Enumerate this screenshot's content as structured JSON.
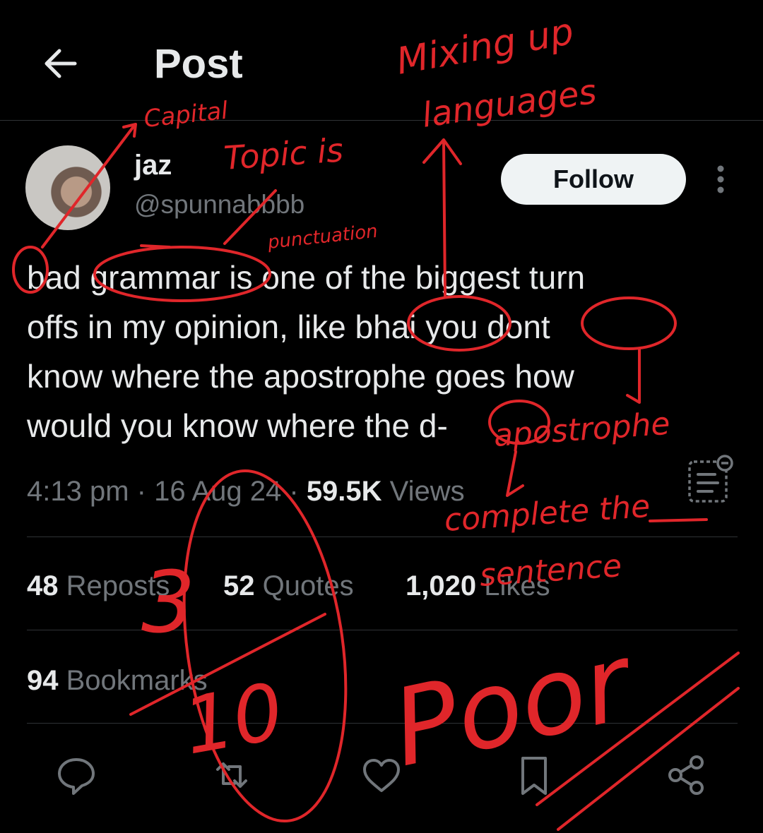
{
  "header": {
    "title": "Post"
  },
  "author": {
    "display_name": "jaz",
    "handle": "@spunnabbbb",
    "follow_label": "Follow"
  },
  "tweet": {
    "lines": [
      "bad grammar is one of the biggest turn",
      "offs in my opinion, like bhai you dont",
      "know where the apostrophe goes how",
      "would you know where the d-"
    ]
  },
  "meta": {
    "time": "4:13 pm",
    "sep1": " · ",
    "date": "16 Aug 24",
    "sep2": " · ",
    "views_count": "59.5K",
    "views_label": " Views"
  },
  "stats": {
    "reposts_count": "48",
    "reposts_label": " Reposts",
    "quotes_count": "52",
    "quotes_label": " Quotes",
    "likes_count": "1,020",
    "likes_label": " Likes",
    "bookmarks_count": "94",
    "bookmarks_label": " Bookmarks"
  },
  "actions": {
    "icons": [
      "reply-icon",
      "repost-icon",
      "like-icon",
      "bookmark-icon",
      "share-icon"
    ]
  },
  "annotations": {
    "capital": "Capital",
    "topic": "Topic is",
    "punctuation": "punctuation",
    "mixing_1": "Mixing up",
    "mixing_2": "languages",
    "apostrophe": "apostrophe",
    "complete_1": "complete the",
    "complete_2": "sentence",
    "score_top": "3",
    "score_bottom": "10",
    "verdict": "Poor",
    "color": "#e0262a"
  },
  "colors": {
    "background": "#000000",
    "text": "#e7e9ea",
    "muted": "#71767b",
    "divider": "#2f3336",
    "annotation": "#e0262a"
  }
}
